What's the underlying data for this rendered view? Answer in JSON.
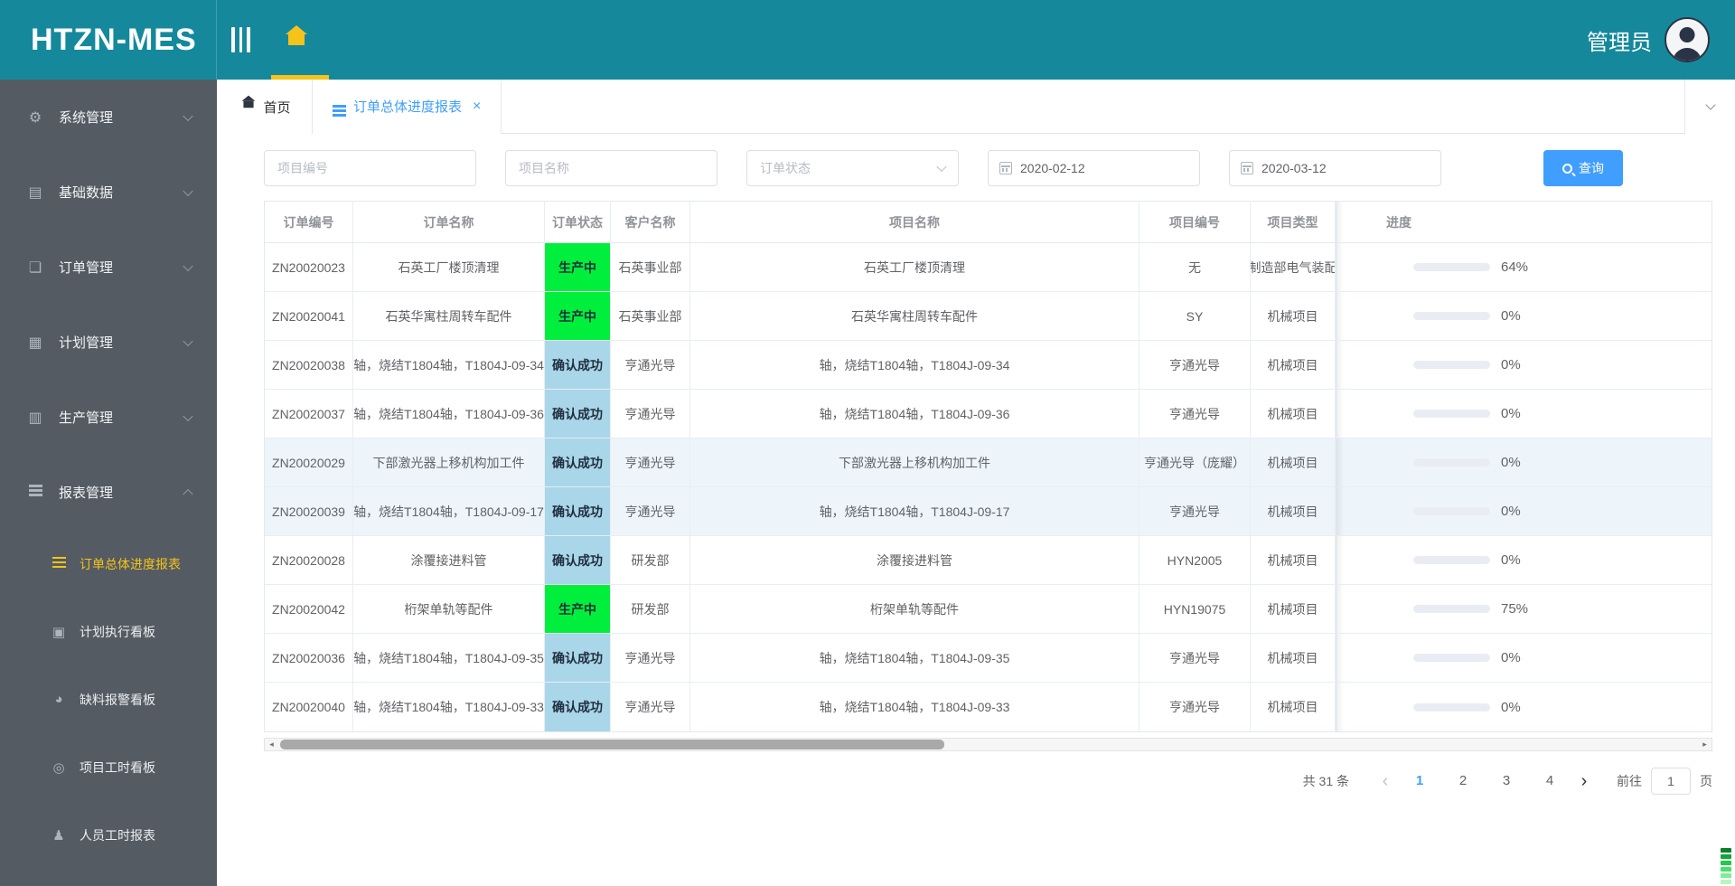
{
  "app": {
    "logo": "HTZN-MES",
    "user": "管理员"
  },
  "tabs": [
    {
      "label": "首页",
      "icon": "home-icon",
      "active": false,
      "closable": false
    },
    {
      "label": "订单总体进度报表",
      "icon": "list-icon",
      "active": true,
      "closable": true,
      "close_glyph": "×"
    }
  ],
  "sidebar": {
    "items": [
      {
        "label": "系统管理",
        "icon": "gear-icon",
        "glyph": "⚙",
        "expanded": false
      },
      {
        "label": "基础数据",
        "icon": "database-icon",
        "glyph": "▤",
        "expanded": false
      },
      {
        "label": "订单管理",
        "icon": "document-icon",
        "glyph": "❏",
        "expanded": false
      },
      {
        "label": "计划管理",
        "icon": "grid-icon",
        "glyph": "▦",
        "expanded": false
      },
      {
        "label": "生产管理",
        "icon": "server-icon",
        "glyph": "▥",
        "expanded": false
      },
      {
        "label": "报表管理",
        "icon": "menu-bars-icon",
        "glyph": "bars",
        "expanded": true,
        "children": [
          {
            "label": "订单总体进度报表",
            "icon": "report-list-icon",
            "glyph": "bars",
            "active": true
          },
          {
            "label": "计划执行看板",
            "icon": "board-icon",
            "glyph": "▣",
            "active": false
          },
          {
            "label": "缺料报警看板",
            "icon": "pie-chart-icon",
            "glyph": "◕",
            "active": false
          },
          {
            "label": "项目工时看板",
            "icon": "clock-icon",
            "glyph": "◎",
            "active": false
          },
          {
            "label": "人员工时报表",
            "icon": "person-icon",
            "glyph": "♟",
            "active": false
          }
        ]
      }
    ]
  },
  "filters": {
    "project_no_placeholder": "项目编号",
    "project_name_placeholder": "项目名称",
    "order_status_placeholder": "订单状态",
    "date_from": "2020-02-12",
    "date_to": "2020-03-12",
    "search_label": "查询"
  },
  "table": {
    "columns": [
      "订单编号",
      "订单名称",
      "订单状态",
      "客户名称",
      "项目名称",
      "项目编号",
      "项目类型",
      "进度"
    ],
    "rows": [
      {
        "order_no": "ZN20020023",
        "order_name": "石英工厂楼顶清理",
        "status": "生产中",
        "status_color": "green",
        "customer": "石英事业部",
        "project_name": "石英工厂楼顶清理",
        "project_no": "无",
        "project_type": "制造部电气装配",
        "progress": 64,
        "striped": false
      },
      {
        "order_no": "ZN20020041",
        "order_name": "石英华寓柱周转车配件",
        "status": "生产中",
        "status_color": "green",
        "customer": "石英事业部",
        "project_name": "石英华寓柱周转车配件",
        "project_no": "SY",
        "project_type": "机械项目",
        "progress": 0,
        "striped": false
      },
      {
        "order_no": "ZN20020038",
        "order_name": "轴，烧结T1804轴，T1804J-09-34",
        "status": "确认成功",
        "status_color": "blue",
        "customer": "亨通光导",
        "project_name": "轴，烧结T1804轴，T1804J-09-34",
        "project_no": "亨通光导",
        "project_type": "机械项目",
        "progress": 0,
        "striped": false
      },
      {
        "order_no": "ZN20020037",
        "order_name": "轴，烧结T1804轴，T1804J-09-36",
        "status": "确认成功",
        "status_color": "blue",
        "customer": "亨通光导",
        "project_name": "轴，烧结T1804轴，T1804J-09-36",
        "project_no": "亨通光导",
        "project_type": "机械项目",
        "progress": 0,
        "striped": false
      },
      {
        "order_no": "ZN20020029",
        "order_name": "下部激光器上移机构加工件",
        "status": "确认成功",
        "status_color": "blue",
        "customer": "亨通光导",
        "project_name": "下部激光器上移机构加工件",
        "project_no": "亨通光导（庞耀）",
        "project_type": "机械项目",
        "progress": 0,
        "striped": true
      },
      {
        "order_no": "ZN20020039",
        "order_name": "轴，烧结T1804轴，T1804J-09-17",
        "status": "确认成功",
        "status_color": "blue",
        "customer": "亨通光导",
        "project_name": "轴，烧结T1804轴，T1804J-09-17",
        "project_no": "亨通光导",
        "project_type": "机械项目",
        "progress": 0,
        "striped": true
      },
      {
        "order_no": "ZN20020028",
        "order_name": "涂覆接进料管",
        "status": "确认成功",
        "status_color": "blue",
        "customer": "研发部",
        "project_name": "涂覆接进料管",
        "project_no": "HYN2005",
        "project_type": "机械项目",
        "progress": 0,
        "striped": false
      },
      {
        "order_no": "ZN20020042",
        "order_name": "桁架单轨等配件",
        "status": "生产中",
        "status_color": "green",
        "customer": "研发部",
        "project_name": "桁架单轨等配件",
        "project_no": "HYN19075",
        "project_type": "机械项目",
        "progress": 75,
        "striped": false
      },
      {
        "order_no": "ZN20020036",
        "order_name": "轴，烧结T1804轴，T1804J-09-35",
        "status": "确认成功",
        "status_color": "blue",
        "customer": "亨通光导",
        "project_name": "轴，烧结T1804轴，T1804J-09-35",
        "project_no": "亨通光导",
        "project_type": "机械项目",
        "progress": 0,
        "striped": false
      },
      {
        "order_no": "ZN20020040",
        "order_name": "轴，烧结T1804轴，T1804J-09-33",
        "status": "确认成功",
        "status_color": "blue",
        "customer": "亨通光导",
        "project_name": "轴，烧结T1804轴，T1804J-09-33",
        "project_no": "亨通光导",
        "project_type": "机械项目",
        "progress": 0,
        "striped": false
      }
    ]
  },
  "pagination": {
    "total_label": "共 31 条",
    "prev_glyph": "‹",
    "next_glyph": "›",
    "pages": [
      "1",
      "2",
      "3",
      "4"
    ],
    "active_page": "1",
    "goto_label": "前往",
    "goto_value": "1",
    "page_unit": "页"
  },
  "colors": {
    "header_teal": "#15899B",
    "sidebar_gray": "#545B63",
    "accent_blue": "#409EFF",
    "active_gold": "#F5C31A",
    "status_green": "#00EE3C",
    "status_lightblue": "#A9D6E8",
    "meter_greens": [
      "#b7f5c2",
      "#7dee95",
      "#4ade6a",
      "#22c94c",
      "#12a53a",
      "#0b7f2c"
    ]
  }
}
